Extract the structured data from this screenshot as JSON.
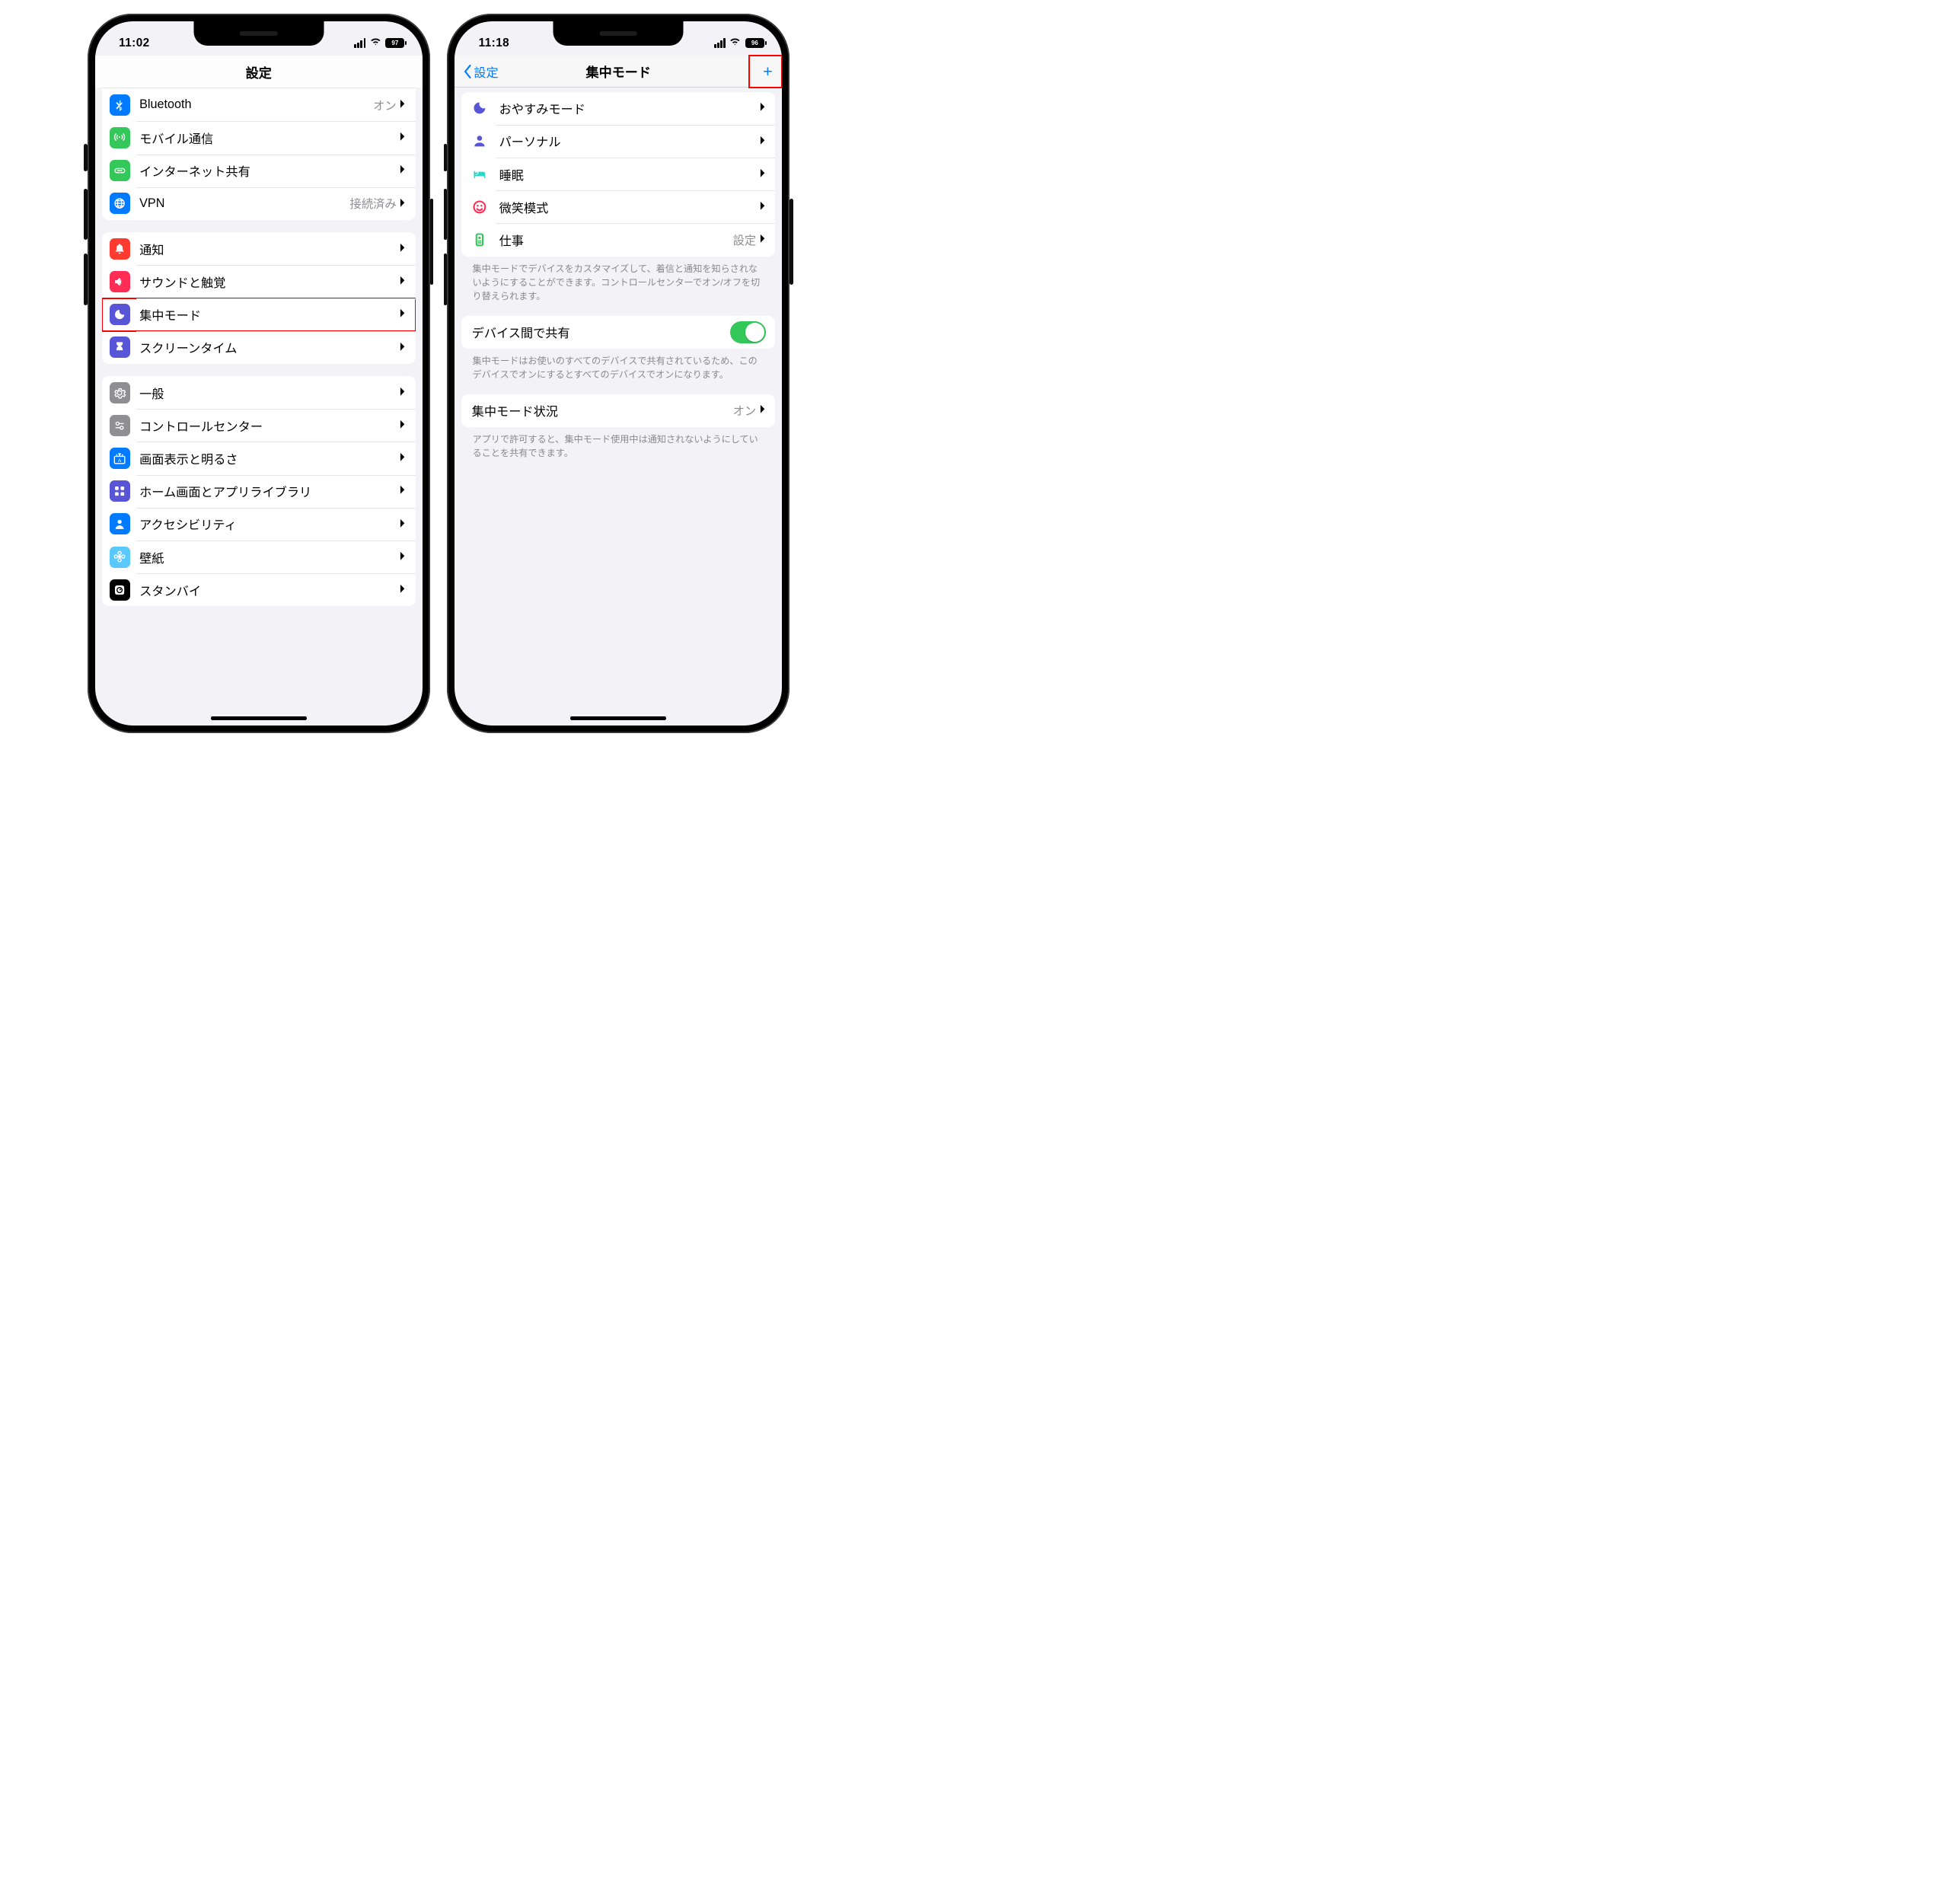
{
  "phone_left": {
    "time": "11:02",
    "battery": "97",
    "nav_title": "設定",
    "groups": [
      {
        "cut_top": true,
        "rows": [
          {
            "icon": "bluetooth",
            "color": "#007aff",
            "label": "Bluetooth",
            "value": "オン",
            "chevron": true
          },
          {
            "icon": "antenna",
            "color": "#34c759",
            "label": "モバイル通信",
            "chevron": true
          },
          {
            "icon": "link",
            "color": "#34c759",
            "label": "インターネット共有",
            "chevron": true
          },
          {
            "icon": "globe",
            "color": "#007aff",
            "label": "VPN",
            "value": "接続済み",
            "chevron": true
          }
        ]
      },
      {
        "rows": [
          {
            "icon": "bell",
            "color": "#ff3b30",
            "label": "通知",
            "chevron": true
          },
          {
            "icon": "sound",
            "color": "#ff2d55",
            "label": "サウンドと触覚",
            "chevron": true
          },
          {
            "icon": "moon",
            "color": "#5856d6",
            "label": "集中モード",
            "chevron": true,
            "highlight": true
          },
          {
            "icon": "hourglass",
            "color": "#5856d6",
            "label": "スクリーンタイム",
            "chevron": true
          }
        ]
      },
      {
        "rows": [
          {
            "icon": "gear",
            "color": "#8e8e93",
            "label": "一般",
            "chevron": true
          },
          {
            "icon": "switches",
            "color": "#8e8e93",
            "label": "コントロールセンター",
            "chevron": true
          },
          {
            "icon": "sun",
            "color": "#007aff",
            "label": "画面表示と明るさ",
            "chevron": true
          },
          {
            "icon": "grid",
            "color": "#5856d6",
            "label": "ホーム画面とアプリライブラリ",
            "chevron": true
          },
          {
            "icon": "person",
            "color": "#007aff",
            "label": "アクセシビリティ",
            "chevron": true
          },
          {
            "icon": "flower",
            "color": "#5ac8fa",
            "label": "壁紙",
            "chevron": true
          },
          {
            "icon": "standby",
            "color": "#000000",
            "label": "スタンバイ",
            "chevron": true
          }
        ]
      }
    ]
  },
  "phone_right": {
    "time": "11:18",
    "battery": "96",
    "nav_back": "設定",
    "nav_title": "集中モード",
    "nav_action": "+",
    "modes": [
      {
        "icon": "moon-o",
        "color": "#5856d6",
        "label": "おやすみモード",
        "chevron": true
      },
      {
        "icon": "person-o",
        "color": "#5856d6",
        "label": "パーソナル",
        "chevron": true
      },
      {
        "icon": "bed",
        "color": "#30d5c8",
        "label": "睡眠",
        "chevron": true
      },
      {
        "icon": "smile",
        "color": "#ff2d55",
        "label": "微笑模式",
        "chevron": true
      },
      {
        "icon": "badge",
        "color": "#34c759",
        "label": "仕事",
        "value": "設定",
        "chevron": true
      }
    ],
    "modes_footer": "集中モードでデバイスをカスタマイズして、着信と通知を知らされないようにすることができます。コントロールセンターでオン/オフを切り替えられます。",
    "share_label": "デバイス間で共有",
    "share_footer": "集中モードはお使いのすべてのデバイスで共有されているため、このデバイスでオンにするとすべてのデバイスでオンになります。",
    "status_label": "集中モード状況",
    "status_value": "オン",
    "status_footer": "アプリで許可すると、集中モード使用中は通知されないようにしていることを共有できます。"
  }
}
